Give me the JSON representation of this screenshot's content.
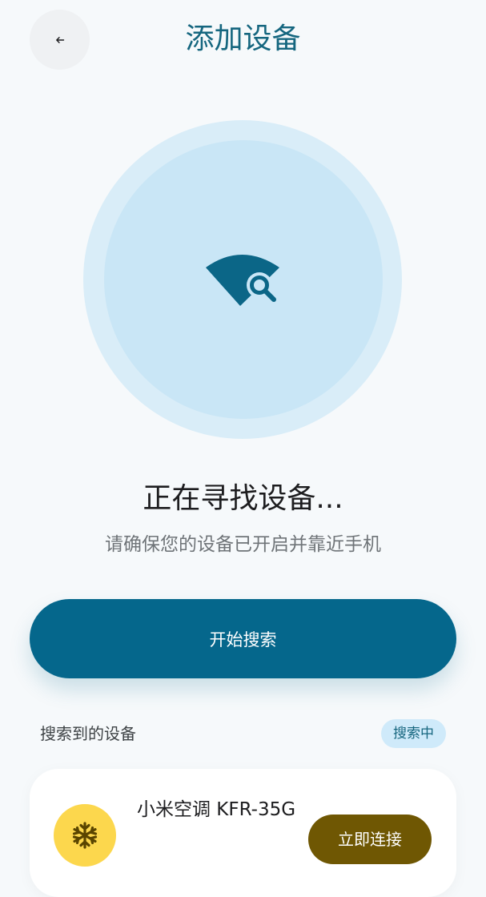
{
  "header": {
    "title": "添加设备",
    "back_icon": "arrow-left-icon"
  },
  "scan": {
    "icon": "wifi-search-icon",
    "status_title": "正在寻找设备...",
    "status_subtitle": "请确保您的设备已开启并靠近手机"
  },
  "actions": {
    "start_search_label": "开始搜索"
  },
  "results": {
    "section_label": "搜索到的设备",
    "status_badge": "搜索中",
    "devices": [
      {
        "name": "小米空调 KFR-35G",
        "icon": "snowflake-icon",
        "connect_label": "立即连接"
      }
    ]
  },
  "colors": {
    "primary": "#05678c",
    "title": "#15667f",
    "accent_yellow": "#fcd74d",
    "connect_button": "#6f5703",
    "badge_bg": "#cfeafa",
    "scan_outer": "#d9edf8",
    "scan_inner": "#c9e6f6"
  }
}
